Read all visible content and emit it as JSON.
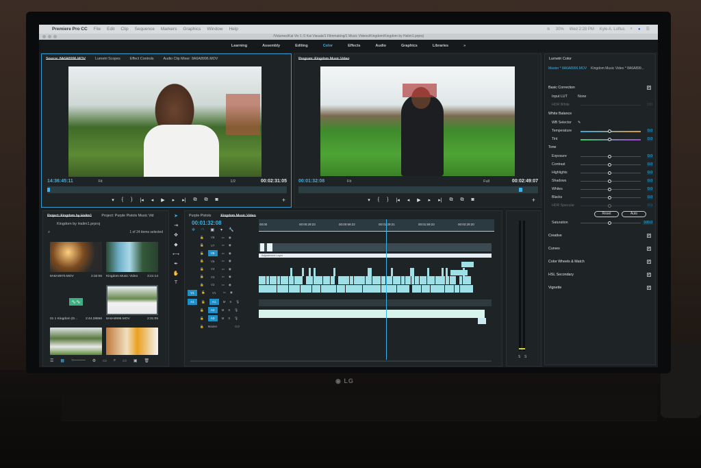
{
  "app": {
    "name": "Premiere Pro CC",
    "menus": [
      "File",
      "Edit",
      "Clip",
      "Sequence",
      "Markers",
      "Graphics",
      "Window",
      "Help"
    ],
    "tray": {
      "battery": "30%",
      "clock": "Wed 2:28 PM",
      "user": "Kyle A. Loftus"
    },
    "path": "/Volumes/Kai Viv 1 /1 Kai Visuals/1 Filmmaking/1 Music Videos/Kingdom/Kingdom by Halim1.prproj"
  },
  "workspaces": {
    "items": [
      "Learning",
      "Assembly",
      "Editing",
      "Color",
      "Effects",
      "Audio",
      "Graphics",
      "Libraries"
    ],
    "active": "Color",
    "more": "»"
  },
  "source": {
    "tabs": [
      "Source: 8A6A8996.MOV",
      "Lumetri Scopes",
      "Effect Controls",
      "Audio Clip Mixer: 8A6A8996.MOV"
    ],
    "timecode": "14:36:45:11",
    "fit": "Fit",
    "resolution": "1/2",
    "duration": "00:02:31:05"
  },
  "program": {
    "tab": "Program: Kingdom Music Video",
    "timecode": "00:01:32:08",
    "fit": "Fit",
    "resolution": "Full",
    "duration": "00:02:49:07"
  },
  "transport": [
    "▾",
    "{",
    "}",
    "|◂",
    "◂",
    "▶",
    "▸",
    "▸|",
    "⧉",
    "⧉",
    "◙"
  ],
  "lumetri": {
    "title": "Lumetri Color",
    "master": "Master * 8A6A8996.MOV",
    "sequence": "Kingdom Music Video * 8A6A899...",
    "basic": "Basic Correction",
    "input_lut_label": "Input LUT",
    "input_lut": "None",
    "hdr_white": "HDR White",
    "hdr_white_val": "100",
    "white_balance": "White Balance",
    "wb_selector": "WB Selector",
    "sliders": [
      {
        "label": "Temperature",
        "value": "0.0"
      },
      {
        "label": "Tint",
        "value": "0.0"
      }
    ],
    "tone": "Tone",
    "tone_sliders": [
      {
        "label": "Exposure",
        "value": "0.0"
      },
      {
        "label": "Contrast",
        "value": "0.0"
      },
      {
        "label": "Highlights",
        "value": "0.0"
      },
      {
        "label": "Shadows",
        "value": "0.0"
      },
      {
        "label": "Whites",
        "value": "0.0"
      },
      {
        "label": "Blacks",
        "value": "0.0"
      },
      {
        "label": "HDR Specular",
        "value": "0.0"
      }
    ],
    "reset": "Reset",
    "auto": "Auto",
    "saturation": "Saturation",
    "saturation_val": "100.0",
    "sections": [
      "Creative",
      "Curves",
      "Color Wheels & Match",
      "HSL Secondary",
      "Vignette"
    ]
  },
  "project": {
    "tabs": [
      "Project: Kingdom by Halim1",
      "Project: Purple Pistols Music Vid"
    ],
    "file": "Kingdom by Halim1.prproj",
    "count": "1 of 24 items selected",
    "items": [
      {
        "name": "8A6A0970.MOV",
        "dur": "2:32:05"
      },
      {
        "name": "Kingdom Music Video",
        "dur": "3:21:14"
      },
      {
        "name": "01 1 Kingdom (D...",
        "dur": "2:44.28656"
      },
      {
        "name": "8A6A8996.MOV",
        "dur": "2:31:05"
      }
    ]
  },
  "timeline": {
    "tabs": [
      "Purple Pistols",
      "Kingdom Music Video"
    ],
    "timecode": "00:01:32:08",
    "ruler": [
      "00:00",
      "00:00:29:23",
      "00:00:59:22",
      "00:01:29:21",
      "00:01:59:23",
      "00:02:29:20"
    ],
    "video_tracks": [
      "V8",
      "V7",
      "V6",
      "V5",
      "V4",
      "V3",
      "V2",
      "V1"
    ],
    "audio_tracks": [
      "A1",
      "A2",
      "A3"
    ],
    "master": "Master",
    "master_val": "0.0",
    "adjustment_layer": "Adjustment Layer",
    "playhead_fraction": 0.54
  },
  "meters": {
    "labels": [
      "S",
      "S"
    ]
  },
  "colors": {
    "accent": "#3ab2ea",
    "clip": "#9fe0e6",
    "audio_clip": "#c8f0e0"
  }
}
